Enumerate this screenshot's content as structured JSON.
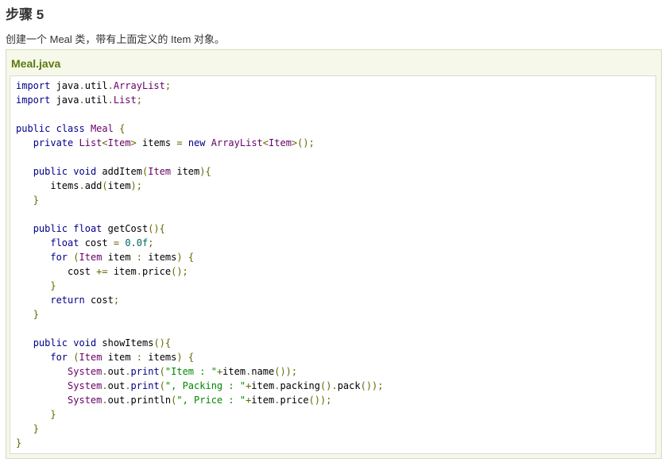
{
  "step_heading": "步骤 5",
  "description": "创建一个 Meal 类，带有上面定义的 Item 对象。",
  "file": {
    "title": "Meal.java",
    "code_lines": [
      [
        [
          "kw",
          "import"
        ],
        [
          "pl",
          " java"
        ],
        [
          "pun",
          "."
        ],
        [
          "pl",
          "util"
        ],
        [
          "pun",
          "."
        ],
        [
          "typ",
          "ArrayList"
        ],
        [
          "pun",
          ";"
        ]
      ],
      [
        [
          "kw",
          "import"
        ],
        [
          "pl",
          " java"
        ],
        [
          "pun",
          "."
        ],
        [
          "pl",
          "util"
        ],
        [
          "pun",
          "."
        ],
        [
          "typ",
          "List"
        ],
        [
          "pun",
          ";"
        ]
      ],
      [],
      [
        [
          "kw",
          "public"
        ],
        [
          "pl",
          " "
        ],
        [
          "kw",
          "class"
        ],
        [
          "pl",
          " "
        ],
        [
          "typ",
          "Meal"
        ],
        [
          "pl",
          " "
        ],
        [
          "pun",
          "{"
        ]
      ],
      [
        [
          "pl",
          "   "
        ],
        [
          "kw",
          "private"
        ],
        [
          "pl",
          " "
        ],
        [
          "typ",
          "List"
        ],
        [
          "pun",
          "<"
        ],
        [
          "typ",
          "Item"
        ],
        [
          "pun",
          ">"
        ],
        [
          "pl",
          " items "
        ],
        [
          "pun",
          "="
        ],
        [
          "pl",
          " "
        ],
        [
          "kw",
          "new"
        ],
        [
          "pl",
          " "
        ],
        [
          "typ",
          "ArrayList"
        ],
        [
          "pun",
          "<"
        ],
        [
          "typ",
          "Item"
        ],
        [
          "pun",
          ">();"
        ]
      ],
      [],
      [
        [
          "pl",
          "   "
        ],
        [
          "kw",
          "public"
        ],
        [
          "pl",
          " "
        ],
        [
          "kw",
          "void"
        ],
        [
          "pl",
          " addItem"
        ],
        [
          "pun",
          "("
        ],
        [
          "typ",
          "Item"
        ],
        [
          "pl",
          " item"
        ],
        [
          "pun",
          "){"
        ]
      ],
      [
        [
          "pl",
          "      items"
        ],
        [
          "pun",
          "."
        ],
        [
          "pl",
          "add"
        ],
        [
          "pun",
          "("
        ],
        [
          "pl",
          "item"
        ],
        [
          "pun",
          ");"
        ]
      ],
      [
        [
          "pl",
          "   "
        ],
        [
          "pun",
          "}"
        ]
      ],
      [],
      [
        [
          "pl",
          "   "
        ],
        [
          "kw",
          "public"
        ],
        [
          "pl",
          " "
        ],
        [
          "kw",
          "float"
        ],
        [
          "pl",
          " getCost"
        ],
        [
          "pun",
          "(){"
        ]
      ],
      [
        [
          "pl",
          "      "
        ],
        [
          "kw",
          "float"
        ],
        [
          "pl",
          " cost "
        ],
        [
          "pun",
          "="
        ],
        [
          "pl",
          " "
        ],
        [
          "lit",
          "0.0f"
        ],
        [
          "pun",
          ";"
        ]
      ],
      [
        [
          "pl",
          "      "
        ],
        [
          "kw",
          "for"
        ],
        [
          "pl",
          " "
        ],
        [
          "pun",
          "("
        ],
        [
          "typ",
          "Item"
        ],
        [
          "pl",
          " item "
        ],
        [
          "pun",
          ":"
        ],
        [
          "pl",
          " items"
        ],
        [
          "pun",
          ")"
        ],
        [
          "pl",
          " "
        ],
        [
          "pun",
          "{"
        ]
      ],
      [
        [
          "pl",
          "         cost "
        ],
        [
          "pun",
          "+="
        ],
        [
          "pl",
          " item"
        ],
        [
          "pun",
          "."
        ],
        [
          "pl",
          "price"
        ],
        [
          "pun",
          "();"
        ]
      ],
      [
        [
          "pl",
          "      "
        ],
        [
          "pun",
          "}"
        ]
      ],
      [
        [
          "pl",
          "      "
        ],
        [
          "kw",
          "return"
        ],
        [
          "pl",
          " cost"
        ],
        [
          "pun",
          ";"
        ]
      ],
      [
        [
          "pl",
          "   "
        ],
        [
          "pun",
          "}"
        ]
      ],
      [],
      [
        [
          "pl",
          "   "
        ],
        [
          "kw",
          "public"
        ],
        [
          "pl",
          " "
        ],
        [
          "kw",
          "void"
        ],
        [
          "pl",
          " showItems"
        ],
        [
          "pun",
          "(){"
        ]
      ],
      [
        [
          "pl",
          "      "
        ],
        [
          "kw",
          "for"
        ],
        [
          "pl",
          " "
        ],
        [
          "pun",
          "("
        ],
        [
          "typ",
          "Item"
        ],
        [
          "pl",
          " item "
        ],
        [
          "pun",
          ":"
        ],
        [
          "pl",
          " items"
        ],
        [
          "pun",
          ")"
        ],
        [
          "pl",
          " "
        ],
        [
          "pun",
          "{"
        ]
      ],
      [
        [
          "pl",
          "         "
        ],
        [
          "typ",
          "System"
        ],
        [
          "pun",
          "."
        ],
        [
          "pl",
          "out"
        ],
        [
          "pun",
          "."
        ],
        [
          "kw",
          "print"
        ],
        [
          "pun",
          "("
        ],
        [
          "str",
          "\"Item : \""
        ],
        [
          "pun",
          "+"
        ],
        [
          "pl",
          "item"
        ],
        [
          "pun",
          "."
        ],
        [
          "pl",
          "name"
        ],
        [
          "pun",
          "());"
        ]
      ],
      [
        [
          "pl",
          "         "
        ],
        [
          "typ",
          "System"
        ],
        [
          "pun",
          "."
        ],
        [
          "pl",
          "out"
        ],
        [
          "pun",
          "."
        ],
        [
          "kw",
          "print"
        ],
        [
          "pun",
          "("
        ],
        [
          "str",
          "\", Packing : \""
        ],
        [
          "pun",
          "+"
        ],
        [
          "pl",
          "item"
        ],
        [
          "pun",
          "."
        ],
        [
          "pl",
          "packing"
        ],
        [
          "pun",
          "()."
        ],
        [
          "pl",
          "pack"
        ],
        [
          "pun",
          "());"
        ]
      ],
      [
        [
          "pl",
          "         "
        ],
        [
          "typ",
          "System"
        ],
        [
          "pun",
          "."
        ],
        [
          "pl",
          "out"
        ],
        [
          "pun",
          "."
        ],
        [
          "pl",
          "println"
        ],
        [
          "pun",
          "("
        ],
        [
          "str",
          "\", Price : \""
        ],
        [
          "pun",
          "+"
        ],
        [
          "pl",
          "item"
        ],
        [
          "pun",
          "."
        ],
        [
          "pl",
          "price"
        ],
        [
          "pun",
          "());"
        ]
      ],
      [
        [
          "pl",
          "      "
        ],
        [
          "pun",
          "}"
        ]
      ],
      [
        [
          "pl",
          "   "
        ],
        [
          "pun",
          "}"
        ]
      ],
      [
        [
          "pun",
          "}"
        ]
      ]
    ]
  },
  "colors": {
    "heading_text": "#333333",
    "file_title": "#5a7a11",
    "panel_bg": "#f6f8e9",
    "keyword": "#000088",
    "type": "#660066",
    "string": "#008800",
    "literal": "#006666",
    "punctuation": "#666600"
  }
}
